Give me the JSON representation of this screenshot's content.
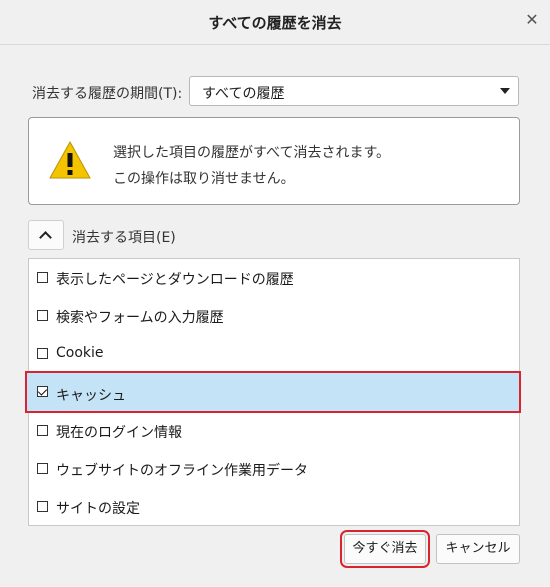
{
  "dialog": {
    "title": "すべての履歴を消去",
    "close_glyph": "✕"
  },
  "period": {
    "label": "消去する履歴の期間(T):",
    "selected": "すべての履歴"
  },
  "warning": {
    "line1": "選択した項目の履歴がすべて消去されます。",
    "line2": "この操作は取り消せません。"
  },
  "items_section": {
    "label": "消去する項目(E)"
  },
  "items": [
    {
      "label": "表示したページとダウンロードの履歴",
      "checked": false
    },
    {
      "label": "検索やフォームの入力履歴",
      "checked": false
    },
    {
      "label": "Cookie",
      "checked": false
    },
    {
      "label": "キャッシュ",
      "checked": true
    },
    {
      "label": "現在のログイン情報",
      "checked": false
    },
    {
      "label": "ウェブサイトのオフライン作業用データ",
      "checked": false
    },
    {
      "label": "サイトの設定",
      "checked": false
    }
  ],
  "buttons": {
    "clear_now": "今すぐ消去",
    "cancel": "キャンセル"
  },
  "colors": {
    "selection_bg": "#c5e3f6",
    "highlight_border": "#d9232e",
    "warning_yellow": "#f5c400"
  }
}
